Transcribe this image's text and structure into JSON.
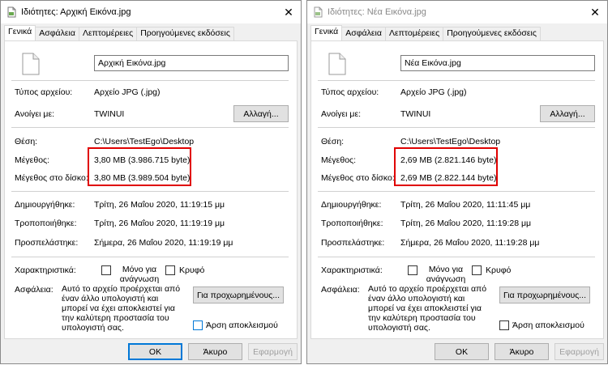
{
  "common": {
    "tabs": [
      "Γενικά",
      "Ασφάλεια",
      "Λεπτομέρειες",
      "Προηγούμενες εκδόσεις"
    ],
    "labels": {
      "type": "Τύπος αρχείου:",
      "opens_with": "Ανοίγει με:",
      "location": "Θέση:",
      "size": "Μέγεθος:",
      "size_on_disk": "Μέγεθος στο δίσκο:",
      "created": "Δημιουργήθηκε:",
      "modified": "Τροποποιήθηκε:",
      "accessed": "Προσπελάστηκε:",
      "attributes": "Χαρακτηριστικά:",
      "security": "Ασφάλεια:"
    },
    "type_value": "Αρχείο JPG (.jpg)",
    "opens_with_value": "TWINUI",
    "change_button": "Αλλαγή...",
    "location_value": "C:\\Users\\TestEgo\\Desktop",
    "attr_readonly": "Μόνο για ανάγνωση",
    "attr_hidden": "Κρυφό",
    "security_text": "Αυτό το αρχείο προέρχεται από έναν άλλο υπολογιστή και μπορεί να έχει αποκλειστεί για την καλύτερη προστασία του υπολογιστή σας.",
    "advanced_button": "Για προχωρημένους...",
    "unblock_label": "Άρση αποκλεισμού",
    "ok": "OK",
    "cancel": "Άκυρο",
    "apply": "Εφαρμογή",
    "close_icon": "close-icon",
    "highlight_color": "#e00000"
  },
  "left": {
    "title": "Ιδιότητες: Αρχική Εικόνα.jpg",
    "filename": "Αρχική Εικόνα.jpg",
    "size": "3,80 MB (3.986.715 byte)",
    "size_on_disk": "3,80 MB (3.989.504 byte)",
    "created": "Τρίτη, 26 Μαΐου 2020, 11:19:15 μμ",
    "modified": "Τρίτη, 26 Μαΐου 2020, 11:19:19 μμ",
    "accessed": "Σήμερα, 26 Μαΐου 2020, 11:19:19 μμ"
  },
  "right": {
    "title": "Ιδιότητες: Νέα Εικόνα.jpg",
    "filename": "Νέα Εικόνα.jpg",
    "size": "2,69 MB (2.821.146 byte)",
    "size_on_disk": "2,69 MB (2.822.144 byte)",
    "created": "Τρίτη, 26 Μαΐου 2020, 11:11:45 μμ",
    "modified": "Τρίτη, 26 Μαΐου 2020, 11:19:28 μμ",
    "accessed": "Σήμερα, 26 Μαΐου 2020, 11:19:28 μμ"
  }
}
